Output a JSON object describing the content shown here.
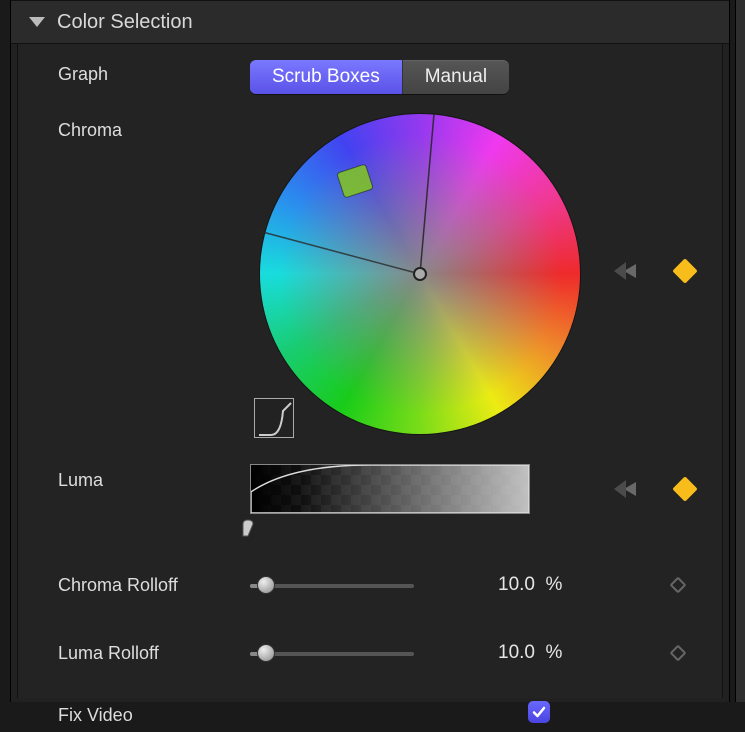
{
  "section": {
    "title": "Color Selection"
  },
  "graph": {
    "label": "Graph",
    "tabs": [
      "Scrub Boxes",
      "Manual"
    ],
    "active_index": 0
  },
  "chroma": {
    "label": "Chroma"
  },
  "luma": {
    "label": "Luma"
  },
  "chroma_rolloff": {
    "label": "Chroma Rolloff",
    "value": "10.0",
    "unit": "%",
    "slider_percent": 10
  },
  "luma_rolloff": {
    "label": "Luma Rolloff",
    "value": "10.0",
    "unit": "%",
    "slider_percent": 10
  },
  "fix_video": {
    "label": "Fix Video",
    "checked": true
  }
}
